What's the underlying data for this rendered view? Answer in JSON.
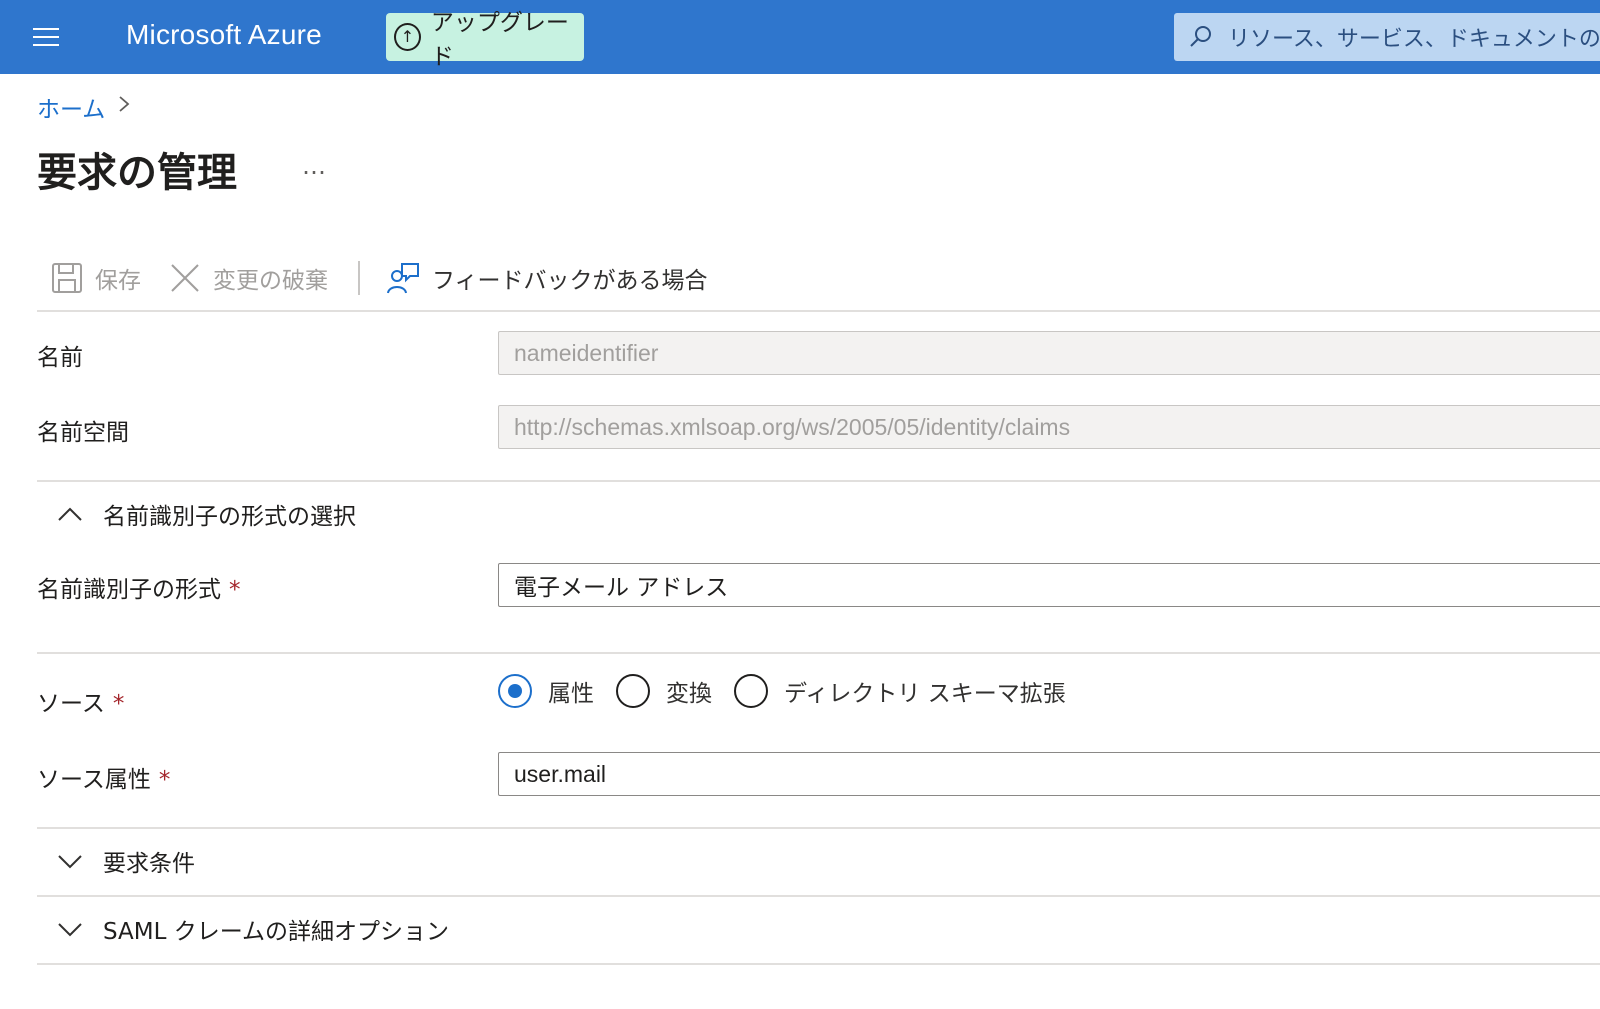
{
  "header": {
    "brand": "Microsoft Azure",
    "upgrade_label": "アップグレード",
    "search_placeholder": "リソース、サービス、ドキュメントの検"
  },
  "breadcrumb": {
    "home": "ホーム",
    "separator": ">"
  },
  "page": {
    "title": "要求の管理",
    "more": "…"
  },
  "toolbar": {
    "save": "保存",
    "discard": "変更の破棄",
    "feedback": "フィードバックがある場合"
  },
  "form": {
    "name_label": "名前",
    "name_value": "nameidentifier",
    "namespace_label": "名前空間",
    "namespace_value": "http://schemas.xmlsoap.org/ws/2005/05/identity/claims",
    "format_section": "名前識別子の形式の選択",
    "format_label": "名前識別子の形式",
    "format_value": "電子メール アドレス",
    "required_mark": "*",
    "source_label": "ソース",
    "source_options": [
      "属性",
      "変換",
      "ディレクトリ スキーマ拡張"
    ],
    "source_selected": "属性",
    "source_attr_label": "ソース属性",
    "source_attr_value": "user.mail",
    "claim_conditions": "要求条件",
    "saml_advanced": "SAML クレームの詳細オプション"
  },
  "colors": {
    "topbar": "#2f76cd",
    "upgrade_bg": "#c7f2e1",
    "link": "#1c6fcb",
    "required": "#a4262c"
  }
}
